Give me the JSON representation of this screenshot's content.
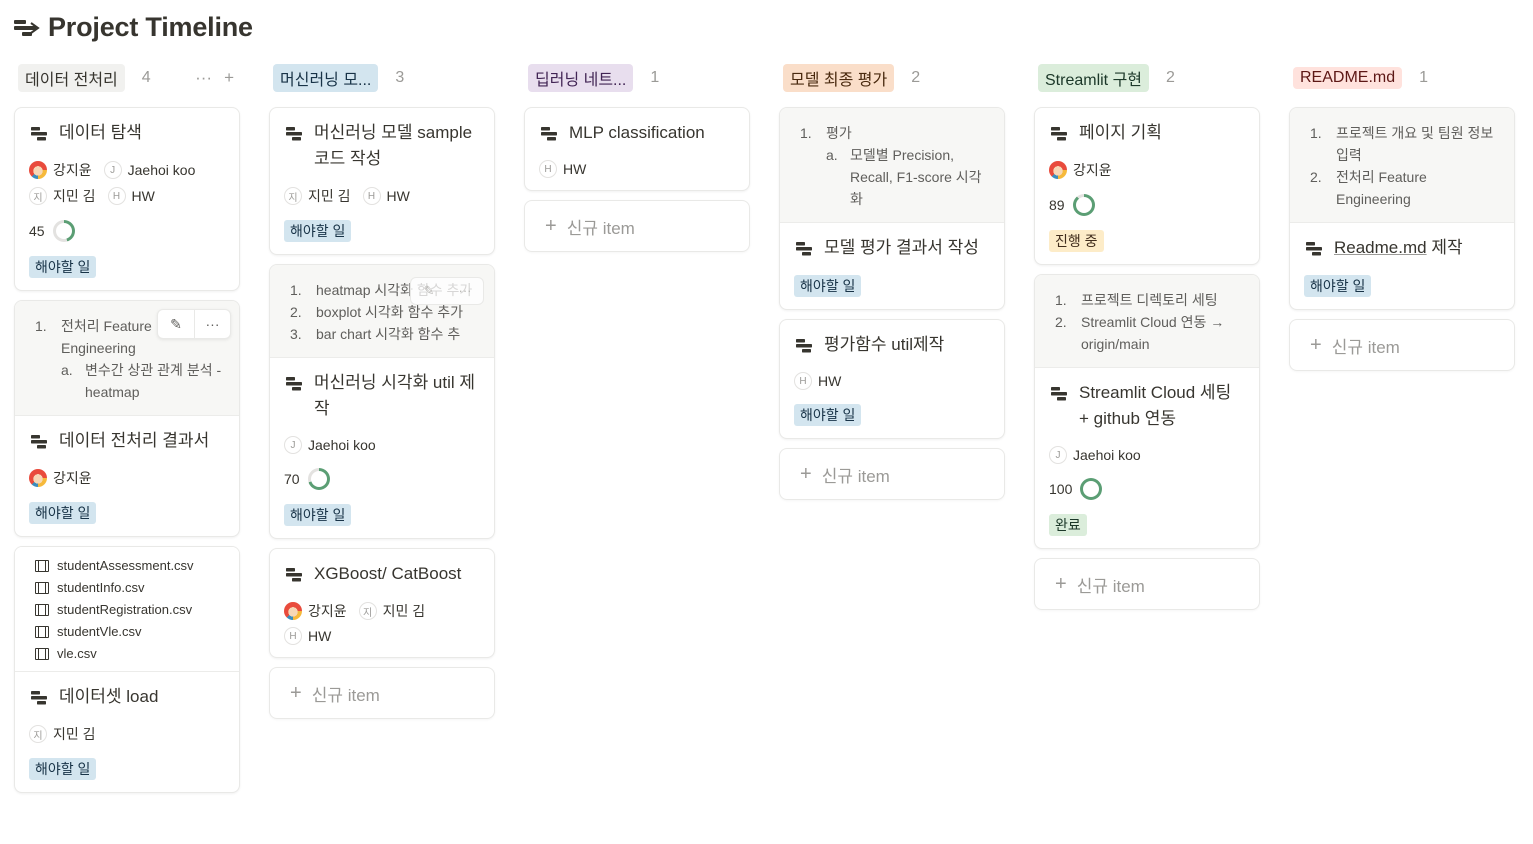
{
  "page": {
    "title": "Project Timeline"
  },
  "colors": {
    "todo": "#d3e5ef",
    "doing": "#fdecc8",
    "done": "#dbeddb",
    "ring": "#5b9e74",
    "ring_track": "#e3e2e0"
  },
  "new_item_label": "신규 item",
  "columns": [
    {
      "name": "데이터 전처리",
      "count": "4",
      "bg": "#f1f1ef",
      "fg": "#37352f",
      "tools": [
        "···",
        "+"
      ],
      "cards": [
        {
          "title": "데이터 탐색",
          "people": [
            [
              "img",
              "강지윤"
            ],
            [
              "J",
              "Jaehoi koo"
            ],
            [
              "지",
              "지민 김"
            ],
            [
              "H",
              "HW"
            ]
          ],
          "progress": 45,
          "status": "해야할 일",
          "status_kind": "todo"
        },
        {
          "preview": [
            {
              "n": "1.",
              "t": "전처리 Feature Engineering"
            },
            {
              "n": "a.",
              "t": "변수간 상관 관계 분석 - heatmap",
              "sub": true
            }
          ],
          "hover": true,
          "title": "데이터 전처리 결과서",
          "people": [
            [
              "img",
              "강지윤"
            ]
          ],
          "status": "해야할 일",
          "status_kind": "todo"
        },
        {
          "files": [
            "studentAssessment.csv",
            "studentInfo.csv",
            "studentRegistration.csv",
            "studentVle.csv",
            "vle.csv"
          ],
          "title": "데이터셋 load",
          "people": [
            [
              "지",
              "지민 김"
            ]
          ],
          "status": "해야할 일",
          "status_kind": "todo"
        }
      ]
    },
    {
      "name": "머신러닝 모...",
      "count": "3",
      "bg": "#d3e5ef",
      "fg": "#183347",
      "cards": [
        {
          "title": "머신러닝 모델 sample 코드 작성",
          "people": [
            [
              "지",
              "지민 김"
            ],
            [
              "H",
              "HW"
            ]
          ],
          "status": "해야할 일",
          "status_kind": "todo"
        },
        {
          "preview": [
            {
              "n": "1.",
              "t": "heatmap 시각화 함수 추가"
            },
            {
              "n": "2.",
              "t": "boxplot 시각화 함수 추가"
            },
            {
              "n": "3.",
              "t": "bar chart 시각화 함수 추"
            }
          ],
          "ghost": true,
          "title": "머신러닝 시각화 util 제작",
          "people": [
            [
              "J",
              "Jaehoi koo"
            ]
          ],
          "progress": 70,
          "status": "해야할 일",
          "status_kind": "todo"
        },
        {
          "title": "XGBoost/ CatBoost",
          "people": [
            [
              "img",
              "강지윤"
            ],
            [
              "지",
              "지민 김"
            ],
            [
              "H",
              "HW"
            ]
          ]
        }
      ]
    },
    {
      "name": "딥러닝 네트...",
      "count": "1",
      "bg": "#e8deee",
      "fg": "#412454",
      "cards": [
        {
          "title": "MLP classification",
          "people": [
            [
              "H",
              "HW"
            ]
          ]
        }
      ]
    },
    {
      "name": "모델 최종 평가",
      "count": "2",
      "bg": "#fadec9",
      "fg": "#49290e",
      "cards": [
        {
          "preview": [
            {
              "n": "1.",
              "t": "평가"
            },
            {
              "n": "a.",
              "t": "모델별 Precision, Recall, F1-score 시각화",
              "sub": true
            }
          ],
          "title": "모델 평가 결과서 작성",
          "people": [],
          "status": "해야할 일",
          "status_kind": "todo"
        },
        {
          "title": "평가함수 util제작",
          "people": [
            [
              "H",
              "HW"
            ]
          ],
          "status": "해야할 일",
          "status_kind": "todo"
        }
      ]
    },
    {
      "name": "Streamlit 구현",
      "count": "2",
      "bg": "#dbeddb",
      "fg": "#1c3829",
      "cards": [
        {
          "title": "페이지 기획",
          "people": [
            [
              "img",
              "강지윤"
            ]
          ],
          "progress": 89,
          "status": "진행 중",
          "status_kind": "doing"
        },
        {
          "preview": [
            {
              "n": "1.",
              "t": "프로젝트 디렉토리 세팅"
            },
            {
              "n": "2.",
              "t": "Streamlit Cloud 연동 → origin/main"
            }
          ],
          "title": "Streamlit Cloud 세팅 + github 연동",
          "people": [
            [
              "J",
              "Jaehoi koo"
            ]
          ],
          "progress": 100,
          "status": "완료",
          "status_kind": "done"
        }
      ]
    },
    {
      "name": "README.md",
      "count": "1",
      "bg": "#ffe2dd",
      "fg": "#5d1715",
      "cards": [
        {
          "preview": [
            {
              "n": "1.",
              "t": "프로젝트 개요 및 팀원 정보 입력"
            },
            {
              "n": "2.",
              "t": "전처리 Feature Engineering"
            }
          ],
          "title": "Readme.md 제작",
          "title_link": "Readme.md",
          "people": [],
          "status": "해야할 일",
          "status_kind": "todo"
        }
      ]
    }
  ]
}
